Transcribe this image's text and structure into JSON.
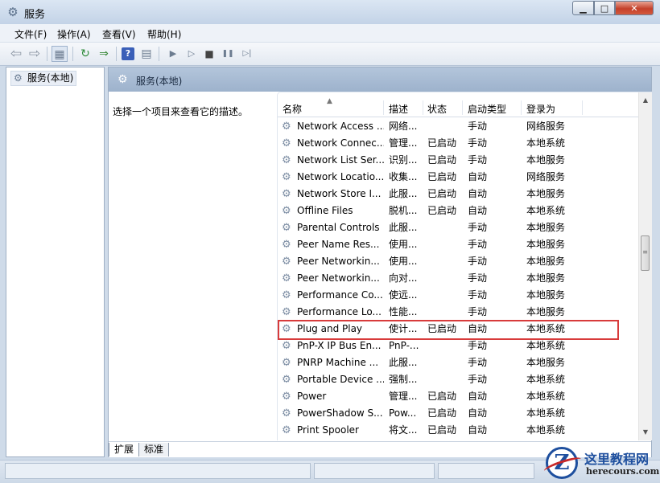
{
  "window": {
    "title": "服务",
    "minimize": "▁",
    "maximize": "□",
    "close": "✕"
  },
  "menu": [
    "文件(F)",
    "操作(A)",
    "查看(V)",
    "帮助(H)"
  ],
  "toolbar": {
    "icons": [
      "back-arrow-icon",
      "forward-arrow-icon",
      "console-tree-icon",
      "refresh-icon",
      "export-list-icon",
      "help-icon",
      "properties-icon",
      "start-service-icon",
      "start-service-alt-icon",
      "stop-service-icon",
      "pause-service-icon",
      "resume-service-icon"
    ],
    "glyphs": {
      "back": "⇦",
      "fwd": "⇨",
      "tree": "▦",
      "refresh": "↻",
      "export": "⇒",
      "help": "?",
      "props": "▤",
      "play": "▶",
      "play2": "▷",
      "stop": "■",
      "pause": "❚❚",
      "resume": "▷|"
    }
  },
  "tree": {
    "item": "服务(本地)"
  },
  "main": {
    "header": "服务(本地)",
    "description": "选择一个项目来查看它的描述。",
    "columns": {
      "name": "名称",
      "desc": "描述",
      "status": "状态",
      "startup": "启动类型",
      "logon": "登录为"
    },
    "rows": [
      {
        "name": "Network Access ...",
        "desc": "网络...",
        "status": "",
        "startup": "手动",
        "logon": "网络服务"
      },
      {
        "name": "Network Connec...",
        "desc": "管理...",
        "status": "已启动",
        "startup": "手动",
        "logon": "本地系统"
      },
      {
        "name": "Network List Ser...",
        "desc": "识别...",
        "status": "已启动",
        "startup": "手动",
        "logon": "本地服务"
      },
      {
        "name": "Network Locatio...",
        "desc": "收集...",
        "status": "已启动",
        "startup": "自动",
        "logon": "网络服务"
      },
      {
        "name": "Network Store I...",
        "desc": "此服...",
        "status": "已启动",
        "startup": "自动",
        "logon": "本地服务"
      },
      {
        "name": "Offline Files",
        "desc": "脱机...",
        "status": "已启动",
        "startup": "自动",
        "logon": "本地系统"
      },
      {
        "name": "Parental Controls",
        "desc": "此服...",
        "status": "",
        "startup": "手动",
        "logon": "本地服务"
      },
      {
        "name": "Peer Name Res...",
        "desc": "使用...",
        "status": "",
        "startup": "手动",
        "logon": "本地服务"
      },
      {
        "name": "Peer Networkin...",
        "desc": "使用...",
        "status": "",
        "startup": "手动",
        "logon": "本地服务"
      },
      {
        "name": "Peer Networkin...",
        "desc": "向对...",
        "status": "",
        "startup": "手动",
        "logon": "本地服务"
      },
      {
        "name": "Performance Co...",
        "desc": "使远...",
        "status": "",
        "startup": "手动",
        "logon": "本地服务"
      },
      {
        "name": "Performance Lo...",
        "desc": "性能...",
        "status": "",
        "startup": "手动",
        "logon": "本地服务"
      },
      {
        "name": "Plug and Play",
        "desc": "使计...",
        "status": "已启动",
        "startup": "自动",
        "logon": "本地系统"
      },
      {
        "name": "PnP-X IP Bus En...",
        "desc": "PnP-...",
        "status": "",
        "startup": "手动",
        "logon": "本地系统"
      },
      {
        "name": "PNRP Machine ...",
        "desc": "此服...",
        "status": "",
        "startup": "手动",
        "logon": "本地服务"
      },
      {
        "name": "Portable Device ...",
        "desc": "强制...",
        "status": "",
        "startup": "手动",
        "logon": "本地系统"
      },
      {
        "name": "Power",
        "desc": "管理...",
        "status": "已启动",
        "startup": "自动",
        "logon": "本地系统"
      },
      {
        "name": "PowerShadow S...",
        "desc": "Pow...",
        "status": "已启动",
        "startup": "自动",
        "logon": "本地系统"
      },
      {
        "name": "Print Spooler",
        "desc": "将文...",
        "status": "已启动",
        "startup": "自动",
        "logon": "本地系统"
      }
    ]
  },
  "tabs": [
    "扩展",
    "标准"
  ],
  "watermark": {
    "letter": "Z",
    "title": "这里教程网",
    "url": "herecours.com"
  },
  "colors": {
    "highlight": "#d83b3b",
    "title_gradient_top": "#dbe6f3",
    "header_band": "#a9bcd4"
  }
}
